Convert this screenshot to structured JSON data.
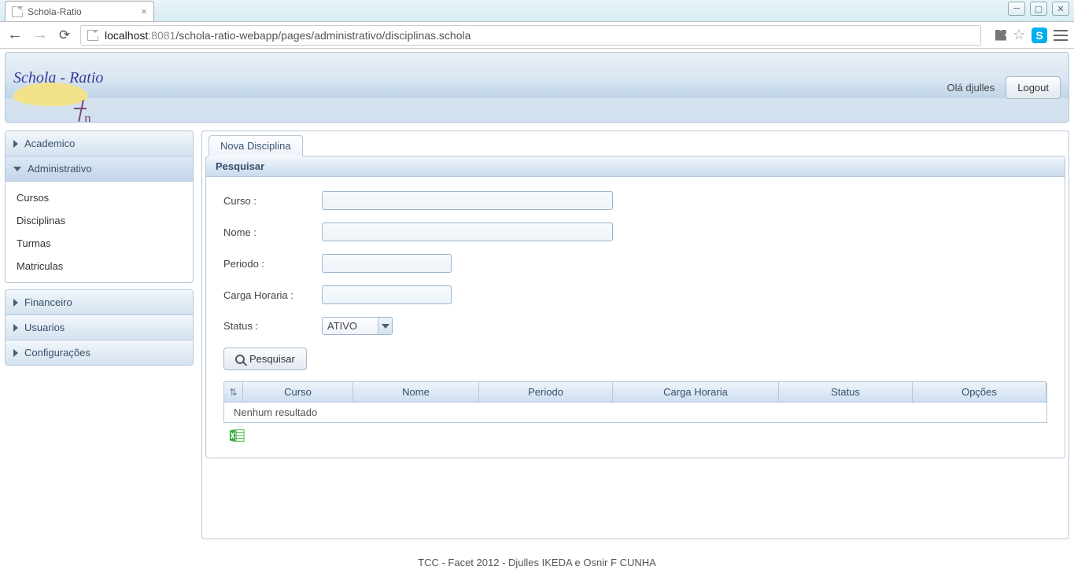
{
  "browser": {
    "tab_title": "Schola-Ratio",
    "url_host": "localhost",
    "url_port": ":8081",
    "url_path": "/schola-ratio-webapp/pages/administrativo/disciplinas.schola"
  },
  "header": {
    "logo_text": "Schola - Ratio",
    "greeting": "Olá djulles",
    "logout": "Logout"
  },
  "sidebar": {
    "groups": {
      "academico": "Academico",
      "administrativo": "Administrativo",
      "financeiro": "Financeiro",
      "usuarios": "Usuarios",
      "configuracoes": "Configurações"
    },
    "admin_items": {
      "cursos": "Cursos",
      "disciplinas": "Disciplinas",
      "turmas": "Turmas",
      "matriculas": "Matriculas"
    }
  },
  "main": {
    "tab_label": "Nova Disciplina",
    "panel_title": "Pesquisar",
    "labels": {
      "curso": "Curso :",
      "nome": "Nome :",
      "periodo": "Periodo :",
      "carga": "Carga Horaria :",
      "status": "Status :"
    },
    "status_value": "ATIVO",
    "search_button": "Pesquisar",
    "grid": {
      "cols": {
        "curso": "Curso",
        "nome": "Nome",
        "periodo": "Periodo",
        "carga": "Carga Horaria",
        "status": "Status",
        "opcoes": "Opções"
      },
      "empty": "Nenhum resultado"
    }
  },
  "footer": "TCC - Facet 2012 - Djulles IKEDA e Osnir F CUNHA"
}
